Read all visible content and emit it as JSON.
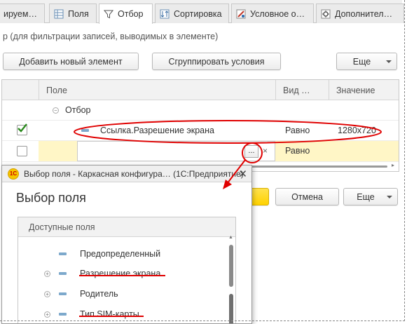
{
  "tabs": [
    {
      "label": "ируем…",
      "icon": "document-icon"
    },
    {
      "label": "Поля",
      "icon": "fields-icon"
    },
    {
      "label": "Отбор",
      "icon": "filter-icon"
    },
    {
      "label": "Сортировка",
      "icon": "sort-icon"
    },
    {
      "label": "Условное о…",
      "icon": "conditional-format-icon"
    },
    {
      "label": "Дополнител…",
      "icon": "settings-icon"
    }
  ],
  "description": "р (для фильтрации записей, выводимых в элементе)",
  "toolbar": {
    "add_label": "Добавить новый элемент",
    "group_label": "Сгруппировать условия",
    "more_label": "Еще"
  },
  "grid": {
    "headers": {
      "field": "Поле",
      "kind": "Вид …",
      "value": "Значение"
    },
    "group_row": {
      "label": "Отбор"
    },
    "rows": [
      {
        "checked": true,
        "field": "Ссылка.Разрешение экрана",
        "kind": "Равно",
        "value": "1280x720"
      },
      {
        "checked": false,
        "field": "",
        "kind": "Равно",
        "value": ""
      }
    ],
    "select_button": "...",
    "clear_button": "×"
  },
  "background_buttons": {
    "cancel_label": "Отмена",
    "more_label": "Еще"
  },
  "dialog": {
    "window_title": "Выбор поля - Каркасная конфигура… (1С:Предприятие)",
    "logo_text": "1С",
    "heading": "Выбор поля",
    "list_header": "Доступные поля",
    "items": [
      {
        "label": "Предопределенный",
        "expandable": false
      },
      {
        "label": "Разрешение экрана",
        "expandable": true
      },
      {
        "label": "Родитель",
        "expandable": true
      },
      {
        "label": "Тип SIM-карты",
        "expandable": true
      }
    ]
  },
  "colors": {
    "accent_red": "#e00000",
    "highlight_yellow": "#fff6c6",
    "check_green": "#2b8a1e",
    "default_button_yellow": "#ffd500"
  }
}
